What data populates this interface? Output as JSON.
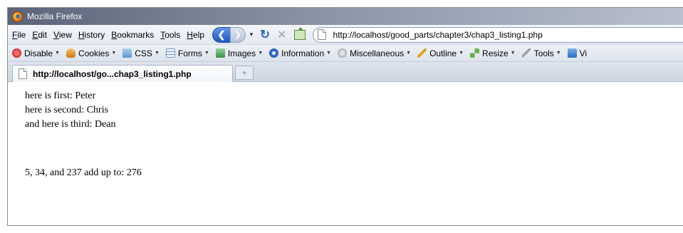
{
  "window": {
    "title": "Mozilla Firefox"
  },
  "menu": {
    "items": [
      "File",
      "Edit",
      "View",
      "History",
      "Bookmarks",
      "Tools",
      "Help"
    ]
  },
  "nav": {
    "back_icon": "back-arrow-icon",
    "forward_icon": "forward-arrow-icon",
    "reload_icon": "reload-icon",
    "stop_icon": "stop-icon",
    "home_icon": "home-icon",
    "url": "http://localhost/good_parts/chapter3/chap3_listing1.php"
  },
  "devbar": {
    "items": [
      "Disable",
      "Cookies",
      "CSS",
      "Forms",
      "Images",
      "Information",
      "Miscellaneous",
      "Outline",
      "Resize",
      "Tools",
      "Vi"
    ]
  },
  "tabs": [
    {
      "label": "http://localhost/go...chap3_listing1.php"
    }
  ],
  "newtab": {
    "label": "+"
  },
  "page": {
    "lines": [
      "here is first: Peter",
      "here is second: Chris",
      "and here is third: Dean"
    ],
    "sum_line": "5, 34, and 237 add up to: 276"
  },
  "colors": {
    "titlebar": "#5b6478",
    "back_button": "#2157c0"
  }
}
